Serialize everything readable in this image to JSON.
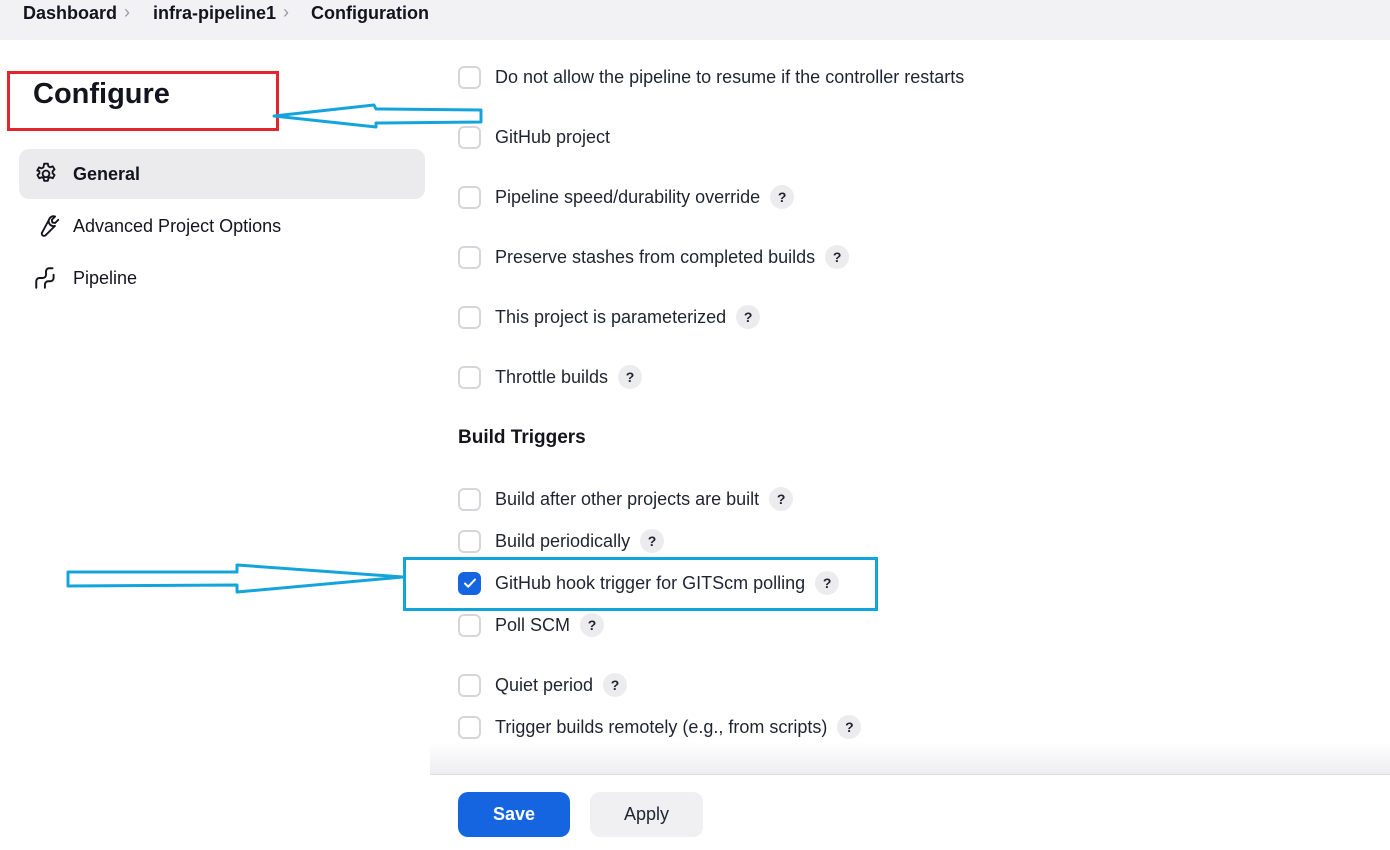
{
  "breadcrumb": [
    "Dashboard",
    "infra-pipeline1",
    "Configuration"
  ],
  "sidebar": {
    "title": "Configure",
    "items": [
      {
        "label": "General",
        "icon": "gear-icon",
        "active": true
      },
      {
        "label": "Advanced Project Options",
        "icon": "wrench-icon",
        "active": false
      },
      {
        "label": "Pipeline",
        "icon": "pipeline-icon",
        "active": false
      }
    ]
  },
  "general_options": [
    {
      "label": "Do not allow the pipeline to resume if the controller restarts",
      "checked": false,
      "help": false
    },
    {
      "label": "GitHub project",
      "checked": false,
      "help": false
    },
    {
      "label": "Pipeline speed/durability override",
      "checked": false,
      "help": true
    },
    {
      "label": "Preserve stashes from completed builds",
      "checked": false,
      "help": true
    },
    {
      "label": "This project is parameterized",
      "checked": false,
      "help": true
    },
    {
      "label": "Throttle builds",
      "checked": false,
      "help": true
    }
  ],
  "build_triggers": {
    "heading": "Build Triggers",
    "options": [
      {
        "label": "Build after other projects are built",
        "checked": false,
        "help": true
      },
      {
        "label": "Build periodically",
        "checked": false,
        "help": true
      },
      {
        "label": "GitHub hook trigger for GITScm polling",
        "checked": true,
        "help": true
      },
      {
        "label": "Poll SCM",
        "checked": false,
        "help": true
      },
      {
        "label": "Quiet period",
        "checked": false,
        "help": true
      },
      {
        "label": "Trigger builds remotely (e.g., from scripts)",
        "checked": false,
        "help": true
      }
    ]
  },
  "help_symbol": "?",
  "buttons": {
    "save": "Save",
    "apply": "Apply"
  },
  "colors": {
    "accent": "#1565e0",
    "annotation_red": "#e3262e",
    "annotation_blue": "#14a4dc"
  }
}
